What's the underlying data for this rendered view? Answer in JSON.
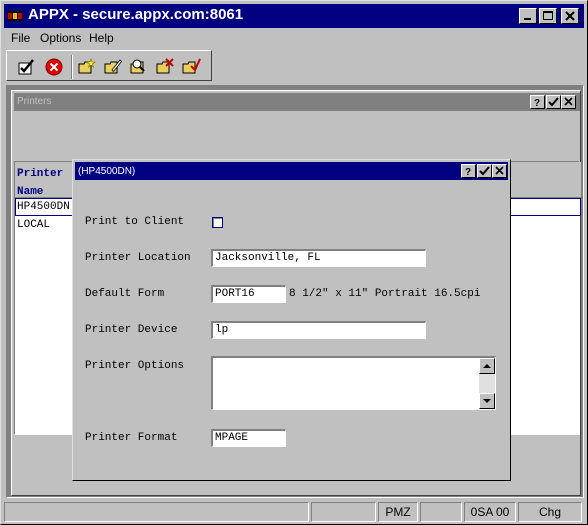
{
  "window": {
    "title": "APPX - secure.appx.com:8061"
  },
  "menu": [
    "File",
    "Options",
    "Help"
  ],
  "toolbar": {
    "buttons": [
      "ok-check-icon",
      "cancel-icon",
      "folder-new-icon",
      "folder-edit-icon",
      "folder-search-icon",
      "folder-delete-icon",
      "folder-cancel-icon"
    ]
  },
  "printers_window": {
    "title": "Printers"
  },
  "printer_list": {
    "header": [
      "Printer",
      "Name"
    ],
    "rows": [
      "HP4500DN",
      "LOCAL"
    ],
    "selected_row": "HP4500DN"
  },
  "detail": {
    "title": "(HP4500DN)",
    "print_to_client_label": "Print to Client",
    "print_to_client_checked": false,
    "location_label": "Printer Location",
    "location_value": "Jacksonville, FL",
    "form_label": "Default Form",
    "form_value": "PORT16",
    "form_description": "8 1/2\" x 11\" Portrait 16.5cpi",
    "device_label": "Printer Device",
    "device_value": "lp",
    "options_label": "Printer Options",
    "options_value": "",
    "format_label": "Printer Format",
    "format_value": "MPAGE"
  },
  "status": {
    "cells": [
      "",
      "",
      "PMZ",
      "",
      "0SA 00",
      "Chg"
    ]
  },
  "colors": {
    "title_active": "#000080",
    "title_inactive": "#808080",
    "face": "#c0c0c0",
    "header_text": "#000080"
  }
}
